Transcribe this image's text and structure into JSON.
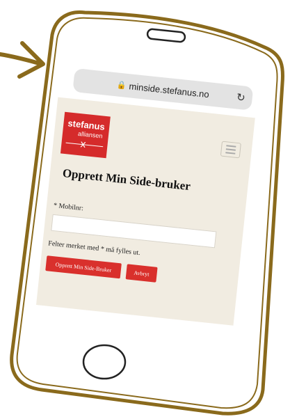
{
  "browser": {
    "url": "minside.stefanus.no",
    "lock_icon": "lock-icon",
    "reload_icon": "reload-icon"
  },
  "logo": {
    "main": "stefanus",
    "sub": "alliansen",
    "color": "#d52b2b"
  },
  "page": {
    "title": "Opprett Min Side-bruker",
    "field_label": "* Mobilnr:",
    "mobile_value": "",
    "note": "Felter merket med * må fylles ut.",
    "create_button": "Opprett Min Side-Bruker",
    "cancel_button": "Avbryt",
    "accent": "#d9302c"
  }
}
